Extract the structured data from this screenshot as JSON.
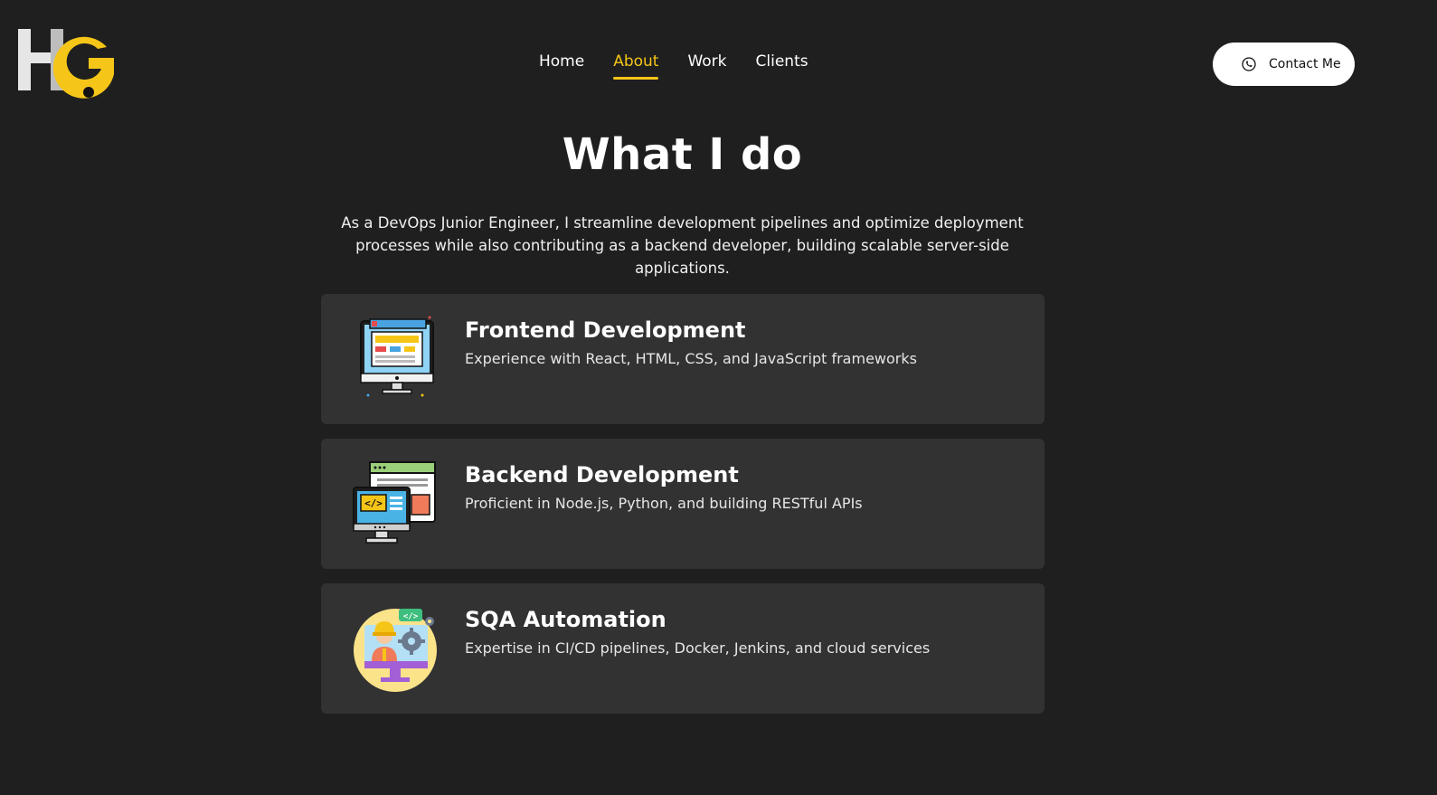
{
  "header": {
    "logo_text": "HG",
    "nav": [
      {
        "label": "Home",
        "active": false
      },
      {
        "label": "About",
        "active": true
      },
      {
        "label": "Work",
        "active": false
      },
      {
        "label": "Clients",
        "active": false
      }
    ],
    "contact_label": "Contact Me"
  },
  "section": {
    "title": "What I do",
    "description": "As a DevOps Junior Engineer, I streamline development pipelines and optimize deployment processes while also contributing as a backend developer, building scalable server-side applications."
  },
  "services": [
    {
      "title": "Frontend Development",
      "description": "Experience with React, HTML, CSS, and JavaScript frameworks",
      "icon": "monitor-web-icon"
    },
    {
      "title": "Backend Development",
      "description": "Proficient in Node.js, Python, and building RESTful APIs",
      "icon": "code-window-icon"
    },
    {
      "title": "SQA Automation",
      "description": "Expertise in CI/CD pipelines, Docker, Jenkins, and cloud services",
      "icon": "engineer-gear-icon"
    }
  ],
  "colors": {
    "background": "#1f1f1f",
    "card": "#323232",
    "accent": "#f5c518",
    "button_bg": "#ffffff"
  }
}
